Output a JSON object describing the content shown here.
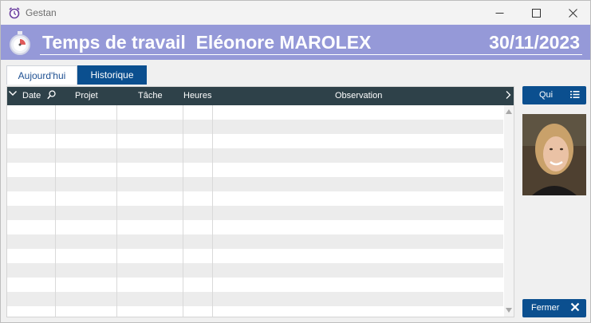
{
  "window": {
    "app_title": "Gestan",
    "app_icon": "alarm-clock-icon",
    "controls": [
      "minimize-icon",
      "maximize-icon",
      "close-icon"
    ]
  },
  "header": {
    "title": "Temps de travail  Eléonore MAROLEX",
    "date": "30/11/2023",
    "icon": "stopwatch-icon",
    "background_color": "#9599d8"
  },
  "tabs": [
    {
      "label": "Aujourd'hui",
      "active": true
    },
    {
      "label": "Historique",
      "active": false
    }
  ],
  "table": {
    "columns": [
      "Date",
      "Projet",
      "Tâche",
      "Heures",
      "Observation"
    ],
    "header_color": "#2e4149",
    "rows": []
  },
  "side": {
    "qui_label": "Qui",
    "qui_icon": "list-icon",
    "fermer_label": "Fermer",
    "fermer_icon": "close-x-icon",
    "photo": "user-photo"
  },
  "colors": {
    "accent": "#0b4f8f",
    "tab_active_text": "#1d4f91"
  }
}
